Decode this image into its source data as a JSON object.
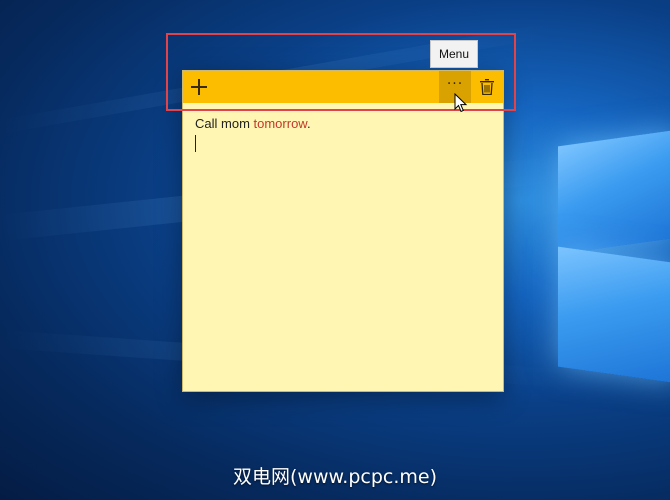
{
  "tooltip": {
    "label": "Menu"
  },
  "note": {
    "text_plain": "Call mom ",
    "text_link": "tomorrow",
    "text_end": ".",
    "colors": {
      "toolbar": "#fcbc00",
      "body": "#fff6b3",
      "link": "#c0392b"
    }
  },
  "toolbar": {
    "add_icon": "plus-icon",
    "menu_icon": "ellipsis-icon",
    "delete_icon": "trash-icon",
    "menu_glyph": "···"
  },
  "highlight": {
    "color": "#e0434a"
  },
  "watermark": {
    "text": "双电网(www.pcpc.me)"
  }
}
